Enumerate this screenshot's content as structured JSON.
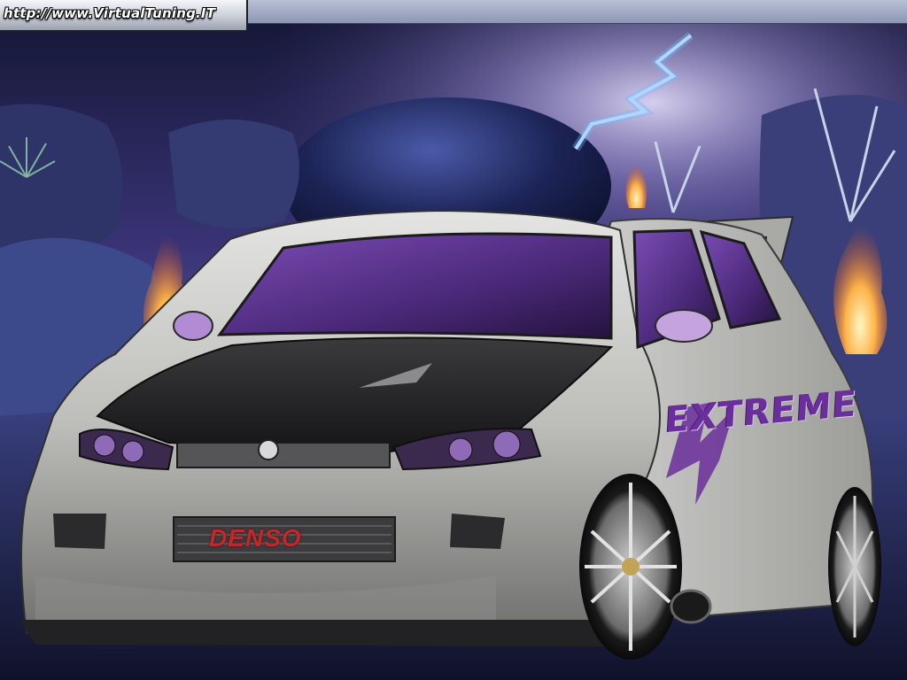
{
  "watermark": {
    "url_text": "http://www.VirtualTuning.IT"
  },
  "decals": {
    "door": "EXTREME",
    "grille": "DENSO"
  },
  "colors": {
    "sky_top": "#1a1c45",
    "sky_glow": "#b6a8e6",
    "lightning": "#cfe9ff",
    "planet": "#1e2a5e",
    "flame": "#ffb347",
    "car_body": "#c9c9c6",
    "hood_carbon": "#2a2a2c",
    "window_tint": "#5a2f8f",
    "decal_extreme": "#6a2f9a",
    "decal_denso": "#c0282a",
    "ground": "#1c1f3d"
  },
  "icons": {
    "brand_badge": "alfa-romeo-badge-icon",
    "lightning": "lightning-bolt-icon",
    "flames": "flame-icon"
  }
}
